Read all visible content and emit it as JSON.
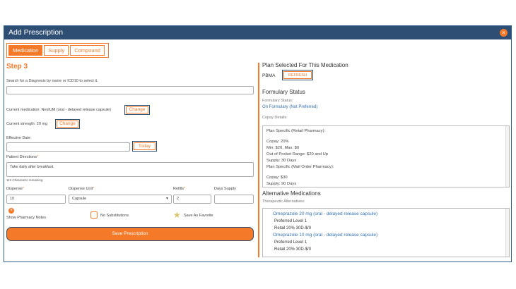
{
  "dialog": {
    "title": "Add Prescription",
    "close_icon": "×"
  },
  "tabs": [
    {
      "label": "Medication"
    },
    {
      "label": "Supply"
    },
    {
      "label": "Compound"
    }
  ],
  "left": {
    "step": "Step 3",
    "diagnosis_label": "Search for a Diagnosis by name or ICD10 to select it.",
    "diagnosis_value": "",
    "current_medication": "Current medication: NexIUM (oral - delayed release capsule)",
    "change_label": "Change",
    "current_strength": "Current strength: 20 mg",
    "effective_date_label": "Effective Date",
    "effective_date_value": "",
    "today_label": "Today",
    "directions_label": "Patient Directions",
    "required_mark": "*",
    "directions_value": "Take daily after breakfast.",
    "chars_remaining": "113 Characters remaining",
    "dispense_label": "Dispense",
    "dispense_value": "10",
    "dispense_unit_label": "Dispense Unit",
    "dispense_unit_value": "Capsule",
    "refills_label": "Refills",
    "refills_value": "2",
    "days_supply_label": "Days Supply",
    "days_supply_value": "",
    "pharmacy_notes_label": "Show Pharmacy Notes",
    "no_substitutions_label": "No Substitutions",
    "save_favorite_label": "Save As Favorite",
    "save_button": "Save Prescription"
  },
  "right": {
    "plan_title": "Plan Selected For This Medication",
    "plan_name": "PBMA",
    "refresh_label": "REFRESH",
    "formulary_title": "Formulary Status",
    "formulary_status_label": "Formulary Status:",
    "formulary_status_value": "On Formulary (Not Preferred)",
    "copay_details_label": "Copay Details:",
    "copay_lines": [
      "Plan Specific (Retail Pharmacy):",
      "",
      "Copay: 20%",
      "Min: $20, Max: $0",
      "Out of Pocket Range: $20 and Up",
      "Supply: 30 Days",
      "Plan Specific (Mail Order Pharmacy):",
      "",
      "Copay: $30",
      "Supply: 90 Days"
    ],
    "alternatives_title": "Alternative Medications",
    "therapeutic_label": "Therapeutic Alternatives:",
    "alternatives": [
      {
        "name": "Omeprazole 20 mg (oral - delayed release capsule)",
        "level": "Preferred Level 1",
        "retail": "Retail 20% 30D-$/0"
      },
      {
        "name": "Omeprazole 10 mg (oral - delayed release capsule)",
        "level": "Preferred Level 1",
        "retail": "Retail 20% 30D-$/0"
      }
    ]
  },
  "colors": {
    "accent": "#f47a2a",
    "titlebar": "#2f4e74",
    "link": "#2f6fb0"
  }
}
